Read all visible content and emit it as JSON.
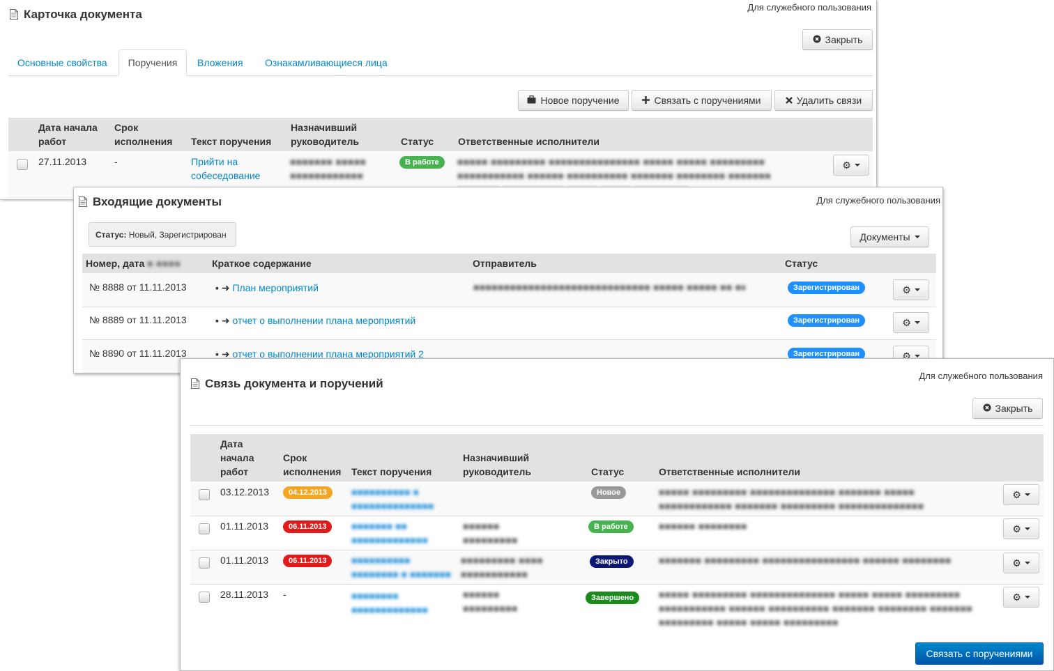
{
  "card": {
    "title": "Карточка документа",
    "classification": "Для служебного пользования",
    "close_label": "Закрыть",
    "tabs": [
      "Основные свойства",
      "Поручения",
      "Вложения",
      "Ознакамливающиеся лица"
    ],
    "active_tab": "Поручения",
    "toolbar": {
      "new_order": "Новое поручение",
      "link_orders": "Связать с поручениями",
      "remove_links": "Удалить связи"
    },
    "columns": [
      "Дата начала работ",
      "Срок исполнения",
      "Текст поручения",
      "Назначивший руководитель",
      "Статус",
      "Ответственные исполнители"
    ],
    "rows": [
      {
        "start": "27.11.2013",
        "deadline": "-",
        "text": "Прийти на собеседование",
        "manager": "■■■■■■■ ■■■■■ ■■■■■■■■■■■■",
        "status": "В работе",
        "assignees": "■■■■■ ■■■■■■■■■ ■■■■■■■■■■■■■■■ ■■■■■ ■■■■■ ■■■■■■■■■ ■■■■■■■■■■■ ■■■■■■ ■■■■■■■■■■ ■■■■■■■ ■■■■■■■■ ■■■■■■■ ■■■■■■■ ■■■■■■■■■■ ■■■■■ ■■■■■ ■■■■■■■■■"
      }
    ]
  },
  "incoming": {
    "title": "Входящие документы",
    "classification": "Для служебного пользования",
    "filter_label": "Статус:",
    "filter_value": "Новый, Зарегистрирован",
    "documents_button": "Документы",
    "columns": [
      "Номер, дата",
      "Краткое содержание",
      "Отправитель",
      "Статус"
    ],
    "rows": [
      {
        "number": "№ 8888 от 11.11.2013",
        "summary": "План мероприятий",
        "sender": "■■■■■■■■■■■■■■■■■■■■■■■■■■■■■ ■■■■■ ■■■■■ ■■ ■■■■",
        "status": "Зарегистрирован"
      },
      {
        "number": "№ 8889 от 11.11.2013",
        "summary": "отчет о выполнении плана мероприятий",
        "sender": "",
        "status": "Зарегистрирован"
      },
      {
        "number": "№ 8890 от 11.11.2013",
        "summary": "отчет о выполнении плана мероприятий 2",
        "sender": "",
        "status": "Зарегистрирован"
      }
    ]
  },
  "link_dialog": {
    "title": "Связь документа и поручений",
    "classification": "Для служебного пользования",
    "close_label": "Закрыть",
    "columns": [
      "Дата начала работ",
      "Срок исполнения",
      "Текст поручения",
      "Назначивший руководитель",
      "Статус",
      "Ответственные исполнители"
    ],
    "rows": [
      {
        "start": "03.12.2013",
        "deadline": "04.12.2013",
        "text": "■■■■■■■■■■ ■ ■■■■■■■■■■■■■■ ■■■■■■",
        "manager": "",
        "status": "Новое",
        "assignees": "■■■■■ ■■■■■■■■■ ■■■■■■■■■■■■■■ ■■■■■■■ ■■■■■ ■■■■■■■■■■■■ ■■■■■■■ ■■■■■■■■■ ■■■■■■■■■■■■■■ ■■■■■■ ■■■■■■■"
      },
      {
        "start": "01.11.2013",
        "deadline": "06.11.2013",
        "text": "■■■■■■■ ■■ ■■■■■■■■■■■■■",
        "manager": "■■■■■■ ■■■■■■■■■ ■■■■■■■■■■■■",
        "status": "В работе",
        "assignees": "■■■■■■ ■■■■■■■■"
      },
      {
        "start": "01.11.2013",
        "deadline": "06.11.2013",
        "text": "■■■■■■■■■■ ■■■■■■■■ ■ ■■■■■■■",
        "manager": "■■■■■■■■■ ■■■■ ■■■■■■■■■■■",
        "status": "Закрыто",
        "assignees": "■■■■■■■ ■■■■■■■■■ ■■■■■■■■■■■■■■■■ ■■■■■■ ■■■■■■■■"
      },
      {
        "start": "28.11.2013",
        "deadline": "-",
        "text": "■■■■■■■■ ■■■■■■■■■■■■■",
        "manager": "■■■■■■ ■■■■■■■■■ ■■■■■■■■■■■■",
        "status": "Завершено",
        "assignees": "■■■■■ ■■■■■■■■■ ■■■■■■■■■■■■■■ ■■■■■ ■■■■■ ■■■■■■■■■ ■■■■■■■■■■■ ■■■■■■ ■■■■■■■■■■ ■■■■■■■ ■■■■■■■■ ■■■■■■■ ■■■■■■■■■ ■■■■■ ■■■■■ ■■■■■■■■■"
      }
    ],
    "submit_label": "Связать с поручениями"
  },
  "colors": {
    "link": "#0088cc",
    "in_work": "#46b34e",
    "registered": "#1e90ff",
    "deadline_orange": "#f5a623",
    "deadline_red": "#e01b1b",
    "new": "#999999",
    "closed": "#0b1875",
    "done": "#1a8a1a",
    "primary": "#0066bb"
  },
  "icons": [
    "document-icon",
    "close-circle-icon",
    "briefcase-icon",
    "plus-icon",
    "x-icon",
    "gear-icon",
    "caret-down-icon",
    "arrow-right-icon"
  ]
}
